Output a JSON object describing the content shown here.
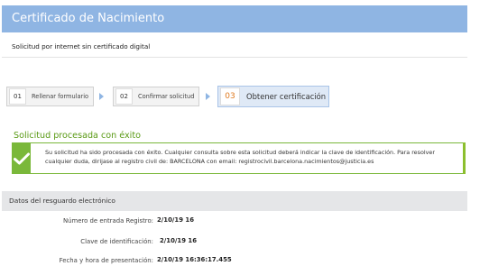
{
  "header": {
    "title": "Certificado de Nacimiento"
  },
  "subheader": {
    "text": "Solicitud por internet sin certificado digital"
  },
  "steps": [
    {
      "num": "01",
      "label": "Rellenar formulario"
    },
    {
      "num": "02",
      "label": "Confirmar solicitud"
    },
    {
      "num": "03",
      "label": "Obtener certificación"
    }
  ],
  "success": {
    "title": "Solicitud procesada con éxito",
    "message": "Su solicitud ha sido procesada con éxito. Cualquier consulta sobre esta solicitud deberá indicar la clave de identificación. Para resolver cualquier duda, dirijase al registro civil de: BARCELONA con email: registrocivil.barcelona.nacimientos@justicia.es"
  },
  "resguardo": {
    "title": "Datos del resguardo electrónico",
    "rows": [
      {
        "label": "Número de entrada Registro:",
        "value": "2/10/19 16"
      },
      {
        "label": "Clave de identificación:",
        "value": "2/10/19 16"
      },
      {
        "label": "Fecha y hora de presentación:",
        "value": "2/10/19 16:36:17.455"
      }
    ]
  },
  "colors": {
    "header": "#8fb5e3",
    "success": "#7ab83a",
    "active_step_number": "#e07a1f"
  },
  "icons": {
    "success": "check-icon",
    "step_arrow": "triangle-right-icon"
  }
}
